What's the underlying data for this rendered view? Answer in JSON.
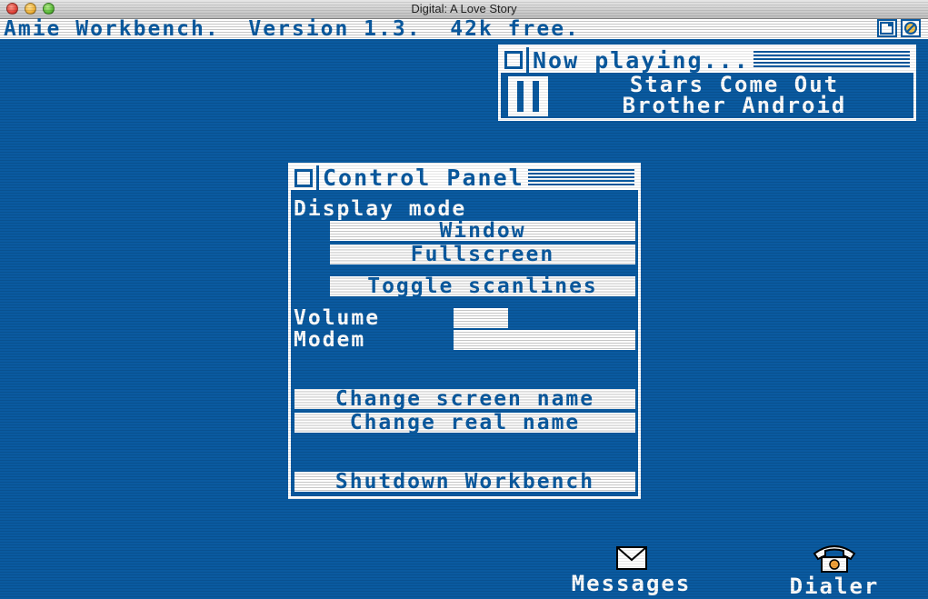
{
  "window": {
    "title": "Digital: A Love Story"
  },
  "workbench": {
    "title": "Amie Workbench.  Version 1.3.  42k free."
  },
  "now_playing": {
    "title": "Now playing...",
    "track": "Stars Come Out",
    "artist": "Brother Android",
    "state": "paused"
  },
  "control_panel": {
    "title": "Control Panel",
    "display_mode_label": "Display mode",
    "window_button": "Window",
    "fullscreen_button": "Fullscreen",
    "toggle_scanlines_button": "Toggle scanlines",
    "volume_label": "Volume",
    "volume_level": 0.3,
    "modem_label": "Modem",
    "modem_level": 1.0,
    "change_screen_name_button": "Change screen name",
    "change_real_name_button": "Change real name",
    "shutdown_button": "Shutdown Workbench"
  },
  "desktop": {
    "messages_label": "Messages",
    "dialer_label": "Dialer"
  },
  "colors": {
    "background": "#0a5aa0",
    "foreground": "#ffffff"
  }
}
